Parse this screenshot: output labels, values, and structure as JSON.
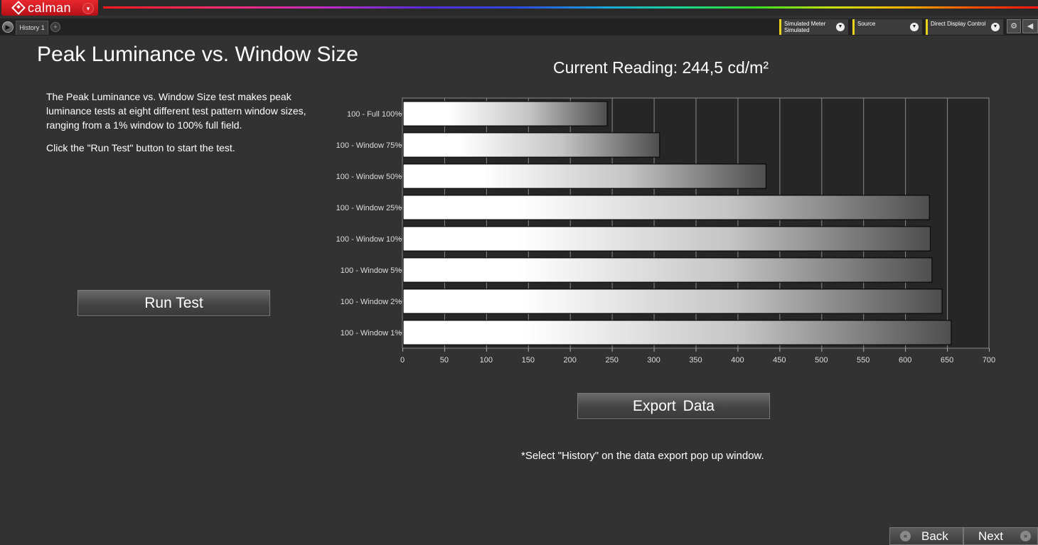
{
  "app": {
    "logo_text": "calman"
  },
  "tabs": {
    "history_label": "History 1"
  },
  "toolbar": {
    "meter": {
      "label": "Simulated Meter",
      "value": "Simulated"
    },
    "source": {
      "label": "Source",
      "value": ""
    },
    "display": {
      "label": "Direct Display Control",
      "value": ""
    }
  },
  "page": {
    "title": "Peak Luminance vs. Window Size",
    "description_1": "The Peak Luminance vs. Window Size test makes peak luminance tests at eight different test pattern window sizes, ranging from a 1% window to 100% full field.",
    "description_2": "Click the \"Run Test\" button to start the test.",
    "run_test_label": "Run Test",
    "current_reading": "Current Reading: 244,5 cd/m²",
    "export_label": "Export Data",
    "footnote": "*Select \"History\" on the data export pop up window."
  },
  "nav": {
    "back_label": "Back",
    "next_label": "Next"
  },
  "colors": {
    "accent_red": "#d9262c",
    "ddl_marker": "#e8d21a",
    "background": "#323232"
  },
  "chart_data": {
    "type": "bar",
    "orientation": "horizontal",
    "categories": [
      "100 - Full  100%",
      "100 - Window 75%",
      "100 - Window 50%",
      "100 - Window 25%",
      "100 - Window 10%",
      "100 - Window  5%",
      "100 - Window  2%",
      "100 - Window  1%"
    ],
    "values": [
      244.5,
      307,
      434,
      629,
      630,
      632,
      644,
      655
    ],
    "xlim": [
      0,
      700
    ],
    "xticks": [
      0,
      50,
      100,
      150,
      200,
      250,
      300,
      350,
      400,
      450,
      500,
      550,
      600,
      650,
      700
    ],
    "grid": true
  }
}
